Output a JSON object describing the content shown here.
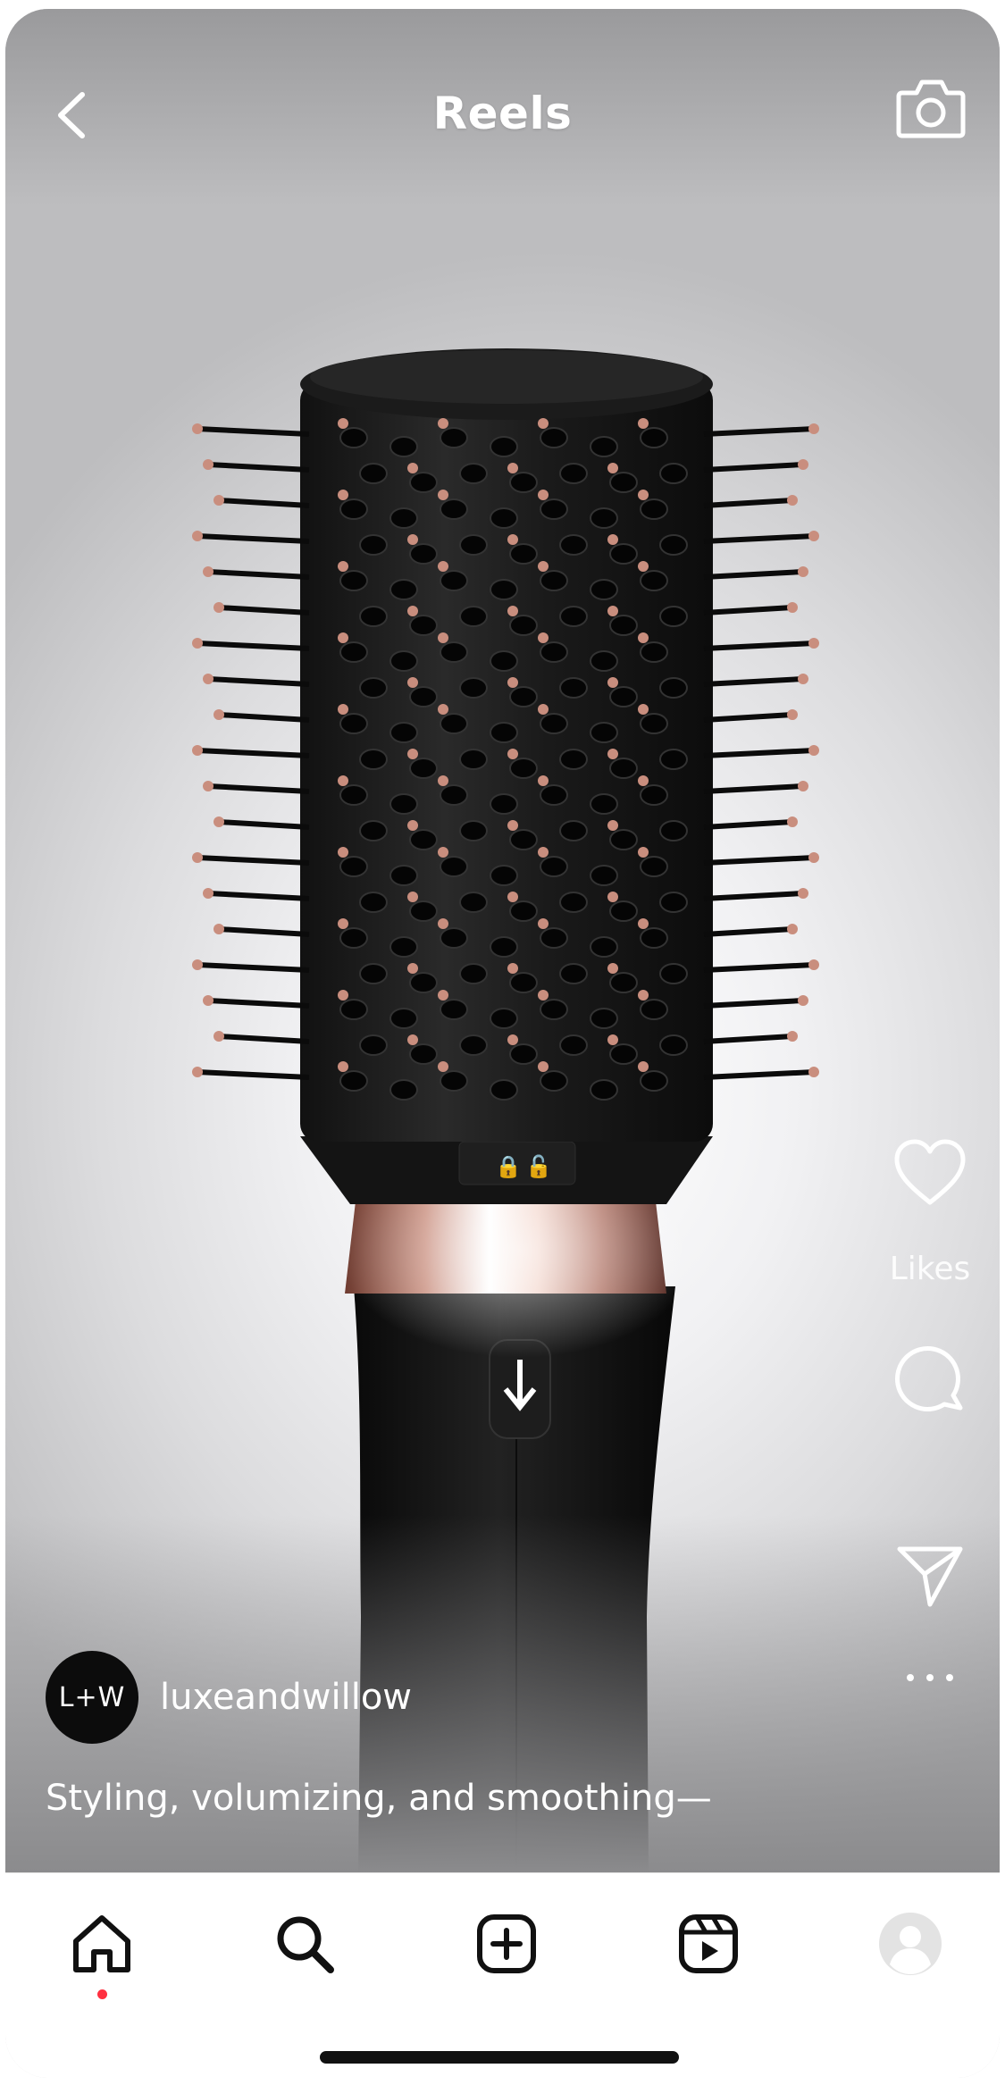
{
  "header": {
    "title": "Reels",
    "back_icon": "chevron-left-icon",
    "camera_icon": "camera-icon"
  },
  "actions": {
    "like_icon": "heart-icon",
    "likes_label": "Likes",
    "comment_icon": "comment-icon",
    "share_icon": "send-icon",
    "more_icon": "more-horizontal-icon"
  },
  "post": {
    "avatar_text": "L+W",
    "username": "luxeandwillow",
    "caption": "Styling, volumizing, and smoothing—"
  },
  "tabbar": {
    "items": [
      {
        "name": "home",
        "icon": "home-icon",
        "active": true
      },
      {
        "name": "search",
        "icon": "search-icon"
      },
      {
        "name": "create",
        "icon": "plus-square-icon"
      },
      {
        "name": "reels",
        "icon": "reels-icon"
      },
      {
        "name": "profile",
        "icon": "profile-avatar-icon"
      }
    ],
    "notification_dot_color": "#ff3040"
  },
  "colors": {
    "accent_rose_gold": "#c98e7e",
    "text_on_video": "#ffffff"
  }
}
